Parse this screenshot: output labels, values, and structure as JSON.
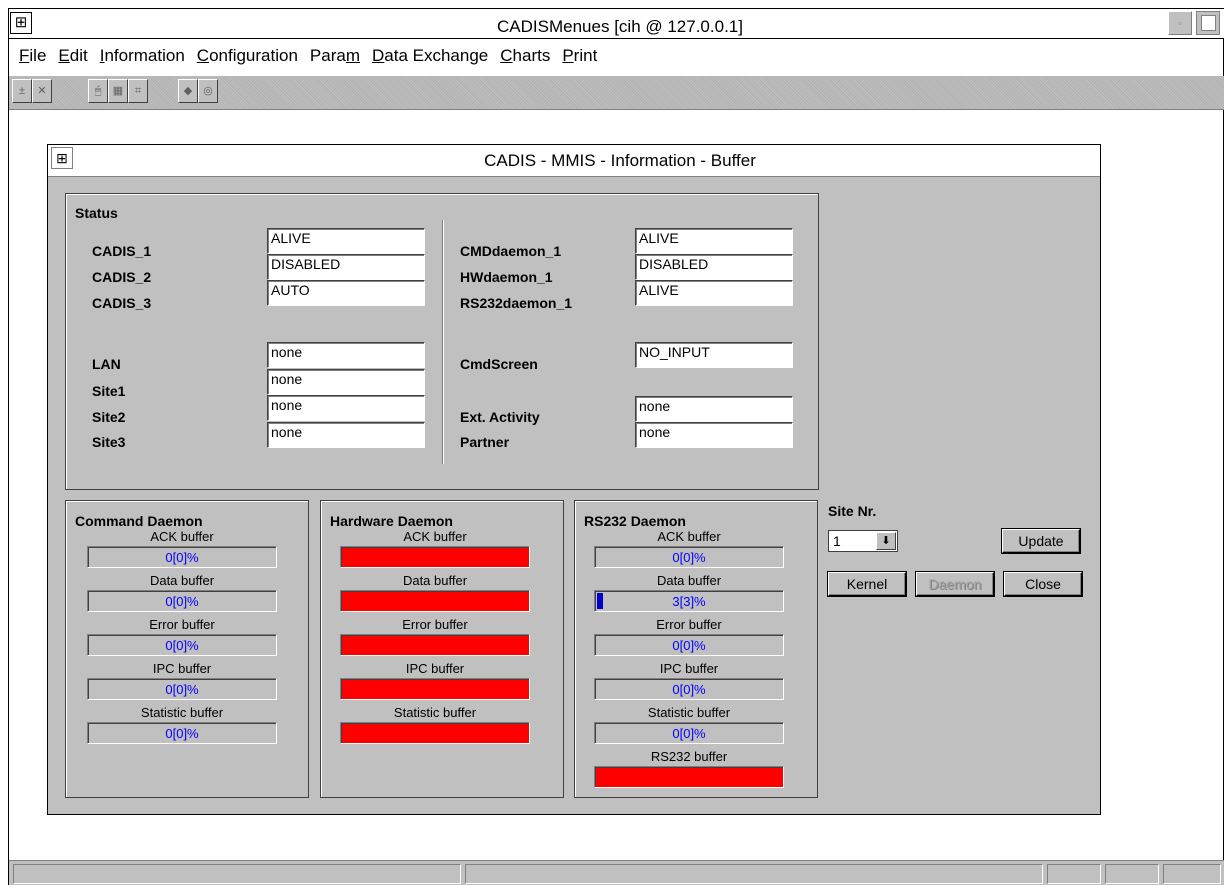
{
  "app": {
    "title": "CADISMenues [cih @ 127.0.0.1]",
    "sys_menu_glyph": "⊞"
  },
  "menu": [
    {
      "pre": "",
      "u": "F",
      "post": "ile"
    },
    {
      "pre": "",
      "u": "E",
      "post": "dit"
    },
    {
      "pre": "",
      "u": "I",
      "post": "nformation"
    },
    {
      "pre": "",
      "u": "C",
      "post": "onfiguration"
    },
    {
      "pre": "Para",
      "u": "m",
      "post": ""
    },
    {
      "pre": "",
      "u": "D",
      "post": "ata Exchange"
    },
    {
      "pre": "",
      "u": "C",
      "post": "harts"
    },
    {
      "pre": "",
      "u": "P",
      "post": "rint"
    }
  ],
  "toolbar": {
    "icons": [
      "plus-minus-icon",
      "cross-icon",
      "mouse-icon",
      "grid-icon",
      "chart-icon",
      "disk-icon",
      "speech-icon"
    ],
    "glyphs": [
      "±",
      "✕",
      "🖱",
      "▦",
      "⌗",
      "◆",
      "◎"
    ]
  },
  "dialog": {
    "title": "CADIS - MMIS - Information - Buffer",
    "status": {
      "title": "Status",
      "left": [
        {
          "label": "CADIS_1",
          "value": "ALIVE"
        },
        {
          "label": "CADIS_2",
          "value": "DISABLED"
        },
        {
          "label": "CADIS_3",
          "value": "AUTO"
        },
        {
          "label": "LAN",
          "value": "none"
        },
        {
          "label": "Site1",
          "value": "none"
        },
        {
          "label": "Site2",
          "value": "none"
        },
        {
          "label": "Site3",
          "value": "none"
        }
      ],
      "right": [
        {
          "label": "CMDdaemon_1",
          "value": "ALIVE"
        },
        {
          "label": "HWdaemon_1",
          "value": "DISABLED"
        },
        {
          "label": "RS232daemon_1",
          "value": "ALIVE"
        },
        {
          "label": "CmdScreen",
          "value": "NO_INPUT"
        },
        {
          "label": "Ext. Activity",
          "value": "none"
        },
        {
          "label": "Partner",
          "value": "none"
        }
      ]
    },
    "command_daemon": {
      "title": "Command Daemon",
      "buffers": [
        {
          "caption": "ACK buffer",
          "text": "0[0]%",
          "level": 0
        },
        {
          "caption": "Data buffer",
          "text": "0[0]%",
          "level": 0
        },
        {
          "caption": "Error buffer",
          "text": "0[0]%",
          "level": 0
        },
        {
          "caption": "IPC buffer",
          "text": "0[0]%",
          "level": 0
        },
        {
          "caption": "Statistic buffer",
          "text": "0[0]%",
          "level": 0
        }
      ]
    },
    "hardware_daemon": {
      "title": "Hardware Daemon",
      "buffers": [
        {
          "caption": "ACK buffer"
        },
        {
          "caption": "Data buffer"
        },
        {
          "caption": "Error buffer"
        },
        {
          "caption": "IPC buffer"
        },
        {
          "caption": "Statistic buffer"
        }
      ]
    },
    "rs232_daemon": {
      "title": "RS232 Daemon",
      "buffers": [
        {
          "caption": "ACK buffer",
          "text": "0[0]%",
          "level": 0
        },
        {
          "caption": "Data buffer",
          "text": "3[3]%",
          "level": 3
        },
        {
          "caption": "Error buffer",
          "text": "0[0]%",
          "level": 0
        },
        {
          "caption": "IPC buffer",
          "text": "0[0]%",
          "level": 0
        },
        {
          "caption": "Statistic buffer",
          "text": "0[0]%",
          "level": 0
        },
        {
          "caption": "RS232 buffer"
        }
      ]
    },
    "site": {
      "label": "Site Nr.",
      "value": "1",
      "arrow_glyph": "⬇"
    },
    "buttons": {
      "update": "Update",
      "kernel": "Kernel",
      "daemon": "Daemon",
      "close": "Close"
    }
  },
  "colors": {
    "alarm": "#ff0000",
    "percent_text": "#0000ff",
    "face": "#c0c0c0"
  }
}
